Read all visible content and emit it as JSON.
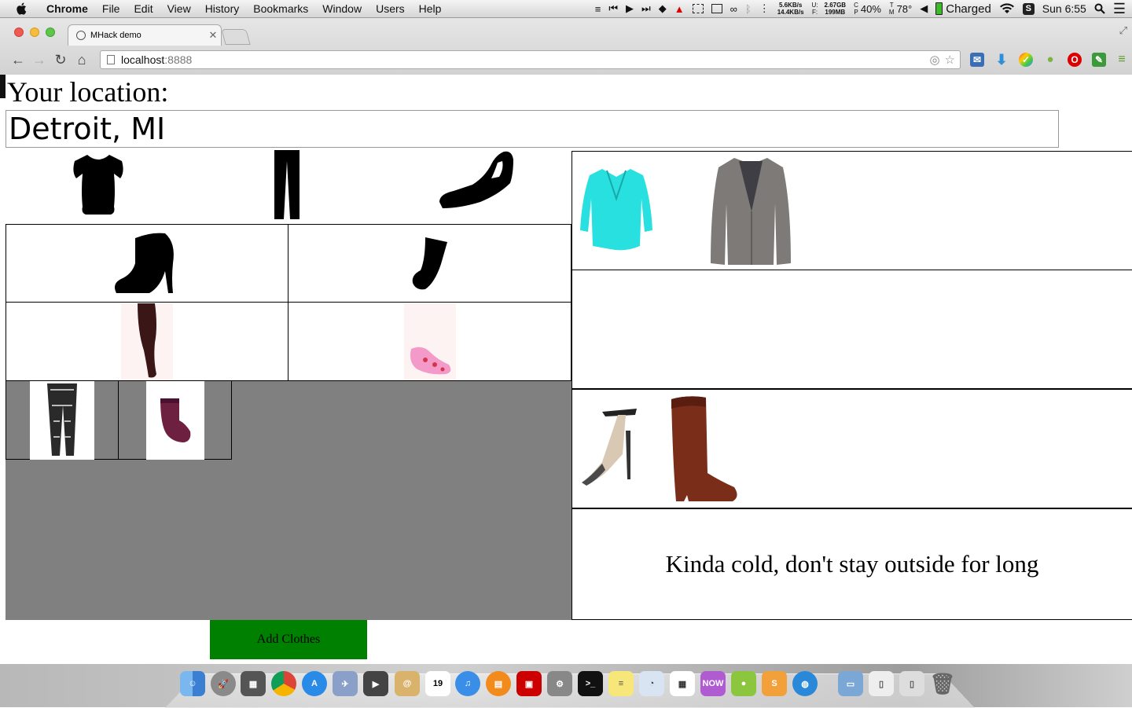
{
  "menubar": {
    "app_name": "Chrome",
    "menus": [
      "File",
      "Edit",
      "View",
      "History",
      "Bookmarks",
      "Window",
      "Users",
      "Help"
    ],
    "network_up": "5.6KB/s",
    "network_down": "14.4KB/s",
    "mem_used_label": "U:",
    "mem_free_label": "F:",
    "mem_used": "2.67GB",
    "mem_free": "199MB",
    "cpu_label_top": "C",
    "cpu_label_bottom": "P",
    "cpu": "40%",
    "temp_label_top": "T",
    "temp_label_bottom": "M",
    "temperature": "78°",
    "battery": "Charged",
    "clock": "Sun 6:55"
  },
  "browser": {
    "tab_title": "MHack demo",
    "url_host": "localhost",
    "url_port": ":8888"
  },
  "page": {
    "location_label": "Your location:",
    "location_value": "Detroit, MI",
    "add_clothes_label": "Add Clothes",
    "weather_message": "Kinda cold, don't stay outside for long"
  },
  "closet": {
    "top_row": [
      "t-shirt-icon",
      "pants-icon",
      "wedge-sandal-icon"
    ],
    "shoe_row": [
      "bootie-icon",
      "sock-icon"
    ],
    "photo_row": [
      "tights-photo",
      "ankle-sock-photo"
    ],
    "items": [
      "lace-leggings-photo",
      "burgundy-sock-photo"
    ]
  },
  "outfit": {
    "tops": [
      "turquoise-blouse-photo",
      "tweed-blazer-photo"
    ],
    "bottoms": [],
    "shoes": [
      "strappy-heel-photo",
      "riding-boot-photo"
    ]
  },
  "colors": {
    "closet_bg": "#808080",
    "add_button": "#008000",
    "blouse": "#29e0e0",
    "blazer": "#7d7a77",
    "boot": "#7a2e1a",
    "burgundy_sock": "#6e2040",
    "pink_sock": "#f49ac8"
  }
}
